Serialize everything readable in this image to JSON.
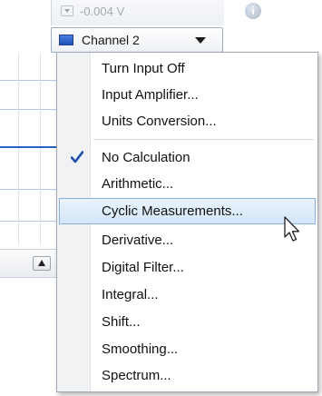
{
  "toolbar": {
    "reading_value": "-0.004 V",
    "info_icon": "i"
  },
  "channel": {
    "label": "Channel 2",
    "color": "#2a5fd0"
  },
  "menu": {
    "items": [
      {
        "label": "Turn Input Off"
      },
      {
        "label": "Input Amplifier..."
      },
      {
        "label": "Units Conversion..."
      },
      {
        "label": "No Calculation",
        "checked": true
      },
      {
        "label": "Arithmetic..."
      },
      {
        "label": "Cyclic Measurements...",
        "highlighted": true
      },
      {
        "label": "Derivative..."
      },
      {
        "label": "Digital Filter..."
      },
      {
        "label": "Integral..."
      },
      {
        "label": "Shift..."
      },
      {
        "label": "Smoothing..."
      },
      {
        "label": "Spectrum..."
      }
    ]
  },
  "icons": {
    "check": "checkmark-icon",
    "cursor": "mouse-pointer-icon",
    "dropdown": "chevron-down-icon"
  },
  "colors": {
    "highlight_border": "#86b2e2",
    "highlight_fill": "#d4e6f8",
    "check": "#1c4fa8"
  }
}
